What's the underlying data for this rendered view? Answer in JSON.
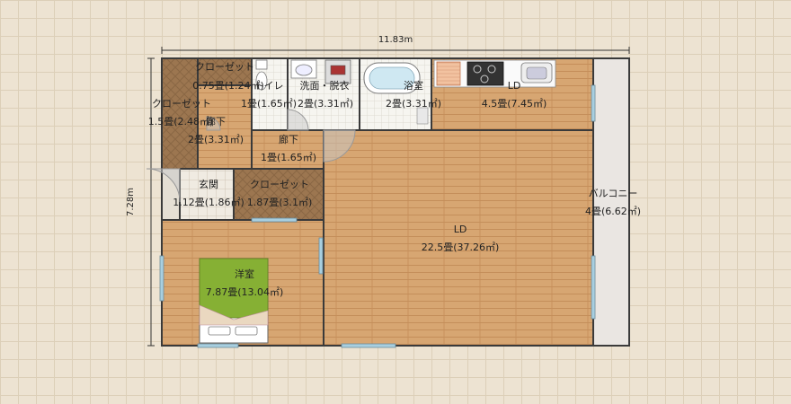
{
  "dimensions": {
    "width_label": "11.83m",
    "depth_label": "7.28m"
  },
  "rooms": {
    "closet_top": {
      "name": "クローゼット",
      "area": "0.75畳(1.24㎡)"
    },
    "closet_left": {
      "name": "クローゼット",
      "area": "1.5畳(2.48㎡)"
    },
    "toilet": {
      "name": "トイレ",
      "area": "1畳(1.65㎡)"
    },
    "washroom": {
      "name": "洗面・脱衣",
      "area": "2畳(3.31㎡)"
    },
    "bathroom": {
      "name": "浴室",
      "area": "2畳(3.31㎡)"
    },
    "kitchen_ld": {
      "name": "LD",
      "area": "4.5畳(7.45㎡)"
    },
    "hall_left": {
      "name": "廊下",
      "area": "2畳(3.31㎡)"
    },
    "hall_mid": {
      "name": "廊下",
      "area": "1畳(1.65㎡)"
    },
    "entrance": {
      "name": "玄関",
      "area": "1.12畳(1.86㎡)"
    },
    "closet_mid": {
      "name": "クローゼット",
      "area": "1.87畳(3.1㎡)"
    },
    "ld_main": {
      "name": "LD",
      "area": "22.5畳(37.26㎡)"
    },
    "balcony": {
      "name": "バルコニー",
      "area": "4畳(6.62㎡)"
    },
    "western_room": {
      "name": "洋室",
      "area": "7.87畳(13.04㎡)"
    }
  },
  "colors": {
    "wood_floor": "#d7a672",
    "closet_floor": "#9c7650",
    "wet_floor": "#f6f5f0",
    "wall": "#3a3a3a",
    "window": "#a8cfe0",
    "balcony": "#eae6e2",
    "bed_cover": "#86b034"
  }
}
